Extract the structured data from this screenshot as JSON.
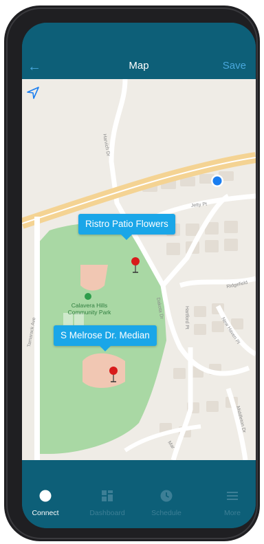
{
  "header": {
    "title": "Map",
    "back_label": "←",
    "save_label": "Save"
  },
  "map": {
    "street_labels": [
      "Harvich Dr",
      "Jetty Pt",
      "Dakota Dr",
      "Hartford Pt",
      "Ridgefield",
      "New Haven Pl",
      "Middleton Dr",
      "Tamarack Ave",
      "Mar"
    ],
    "park_name": "Calavera Hills\nCommunity Park",
    "pins": [
      {
        "label": "Ristro Patio Flowers"
      },
      {
        "label": "S Melrose Dr. Median"
      }
    ]
  },
  "tabs": [
    {
      "label": "Connect",
      "icon": "circle-icon",
      "active": true
    },
    {
      "label": "Dashboard",
      "icon": "grid-icon",
      "active": false
    },
    {
      "label": "Schedule",
      "icon": "clock-icon",
      "active": false
    },
    {
      "label": "More",
      "icon": "menu-icon",
      "active": false
    }
  ],
  "colors": {
    "header_bg": "#0d5f78",
    "accent": "#4aa8dd",
    "callout": "#1aa6e8",
    "park": "#a9d8a4",
    "pin": "#d81b1b"
  }
}
